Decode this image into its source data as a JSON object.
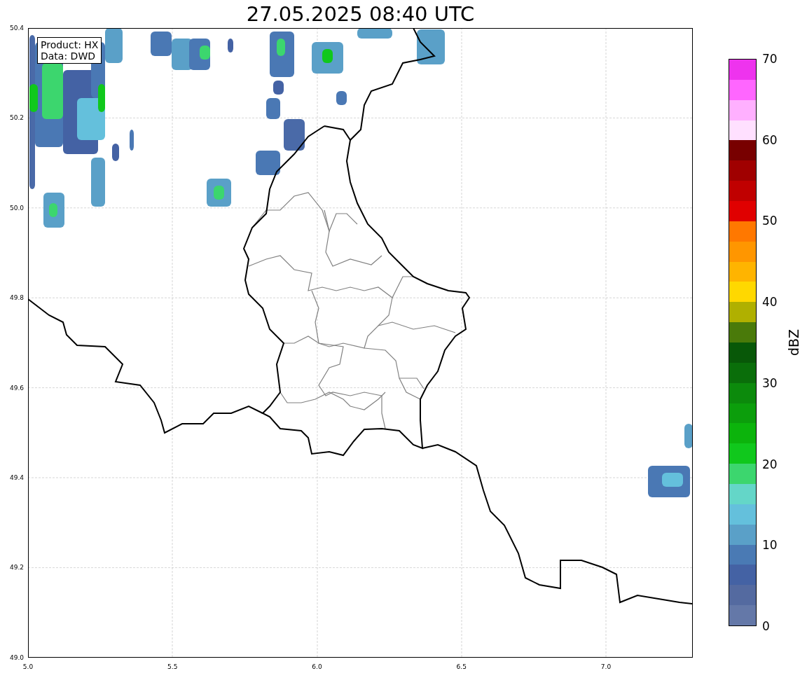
{
  "title": "27.05.2025 08:40 UTC",
  "map": {
    "info_lines": [
      "Product: HX",
      "Data: DWD"
    ],
    "x_ticks": [
      "5.0",
      "5.5",
      "6.0",
      "6.5",
      "7.0"
    ],
    "y_ticks": [
      "50.4",
      "50.2",
      "50.0",
      "49.8",
      "49.6",
      "49.4",
      "49.2",
      "49.0"
    ]
  },
  "colorbar": {
    "label": "dBZ",
    "ticks": [
      "70",
      "60",
      "50",
      "40",
      "30",
      "20",
      "10",
      "0"
    ],
    "bins": [
      {
        "color": "#6478a8"
      },
      {
        "color": "#546aa0"
      },
      {
        "color": "#4462a4"
      },
      {
        "color": "#4a7ab4"
      },
      {
        "color": "#5aa0c8"
      },
      {
        "color": "#64c0dc"
      },
      {
        "color": "#64d6c8"
      },
      {
        "color": "#3cd66e"
      },
      {
        "color": "#10c81c"
      },
      {
        "color": "#0cb40c"
      },
      {
        "color": "#0c9e0c"
      },
      {
        "color": "#0c8a0c"
      },
      {
        "color": "#0a6e0a"
      },
      {
        "color": "#085808"
      },
      {
        "color": "#4a7a0a"
      },
      {
        "color": "#b0b000"
      },
      {
        "color": "#ffd800"
      },
      {
        "color": "#ffb400"
      },
      {
        "color": "#ff9600"
      },
      {
        "color": "#ff7800"
      },
      {
        "color": "#e00000"
      },
      {
        "color": "#c00000"
      },
      {
        "color": "#a00000"
      },
      {
        "color": "#780000"
      },
      {
        "color": "#ffe0ff"
      },
      {
        "color": "#ffb0ff"
      },
      {
        "color": "#ff66ff"
      },
      {
        "color": "#ee33ee"
      }
    ]
  }
}
